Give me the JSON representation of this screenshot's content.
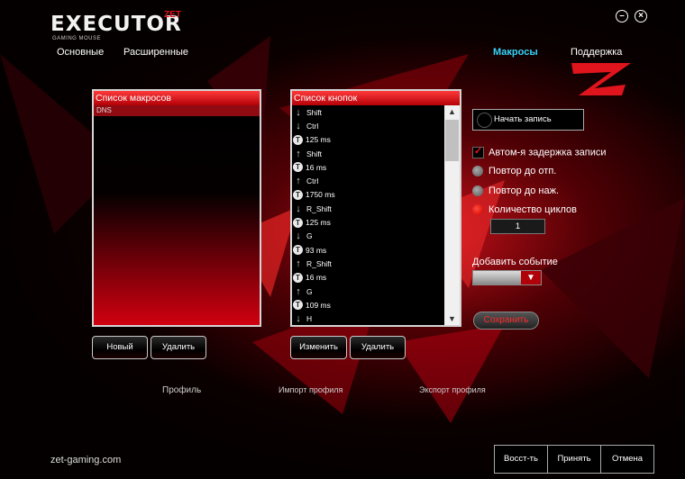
{
  "app": {
    "logo_main": "EXECUTOR",
    "logo_brand": "ZET",
    "logo_sub": "GAMING MOUSE",
    "minimize_icon": "minimize-icon",
    "close_icon": "close-icon"
  },
  "nav": {
    "basic": "Основные",
    "advanced": "Расширенные",
    "macros": "Макросы",
    "support": "Поддержка"
  },
  "macro_panel": {
    "title": "Список макросов",
    "items": [
      "DNS"
    ],
    "new_label": "Новый",
    "delete_label": "Удалить"
  },
  "button_panel": {
    "title": "Список кнопок",
    "rows": [
      {
        "icon": "arrow-down-icon",
        "text": "Shift"
      },
      {
        "icon": "arrow-down-icon",
        "text": "Ctrl"
      },
      {
        "icon": "timer-icon",
        "text": "125 ms"
      },
      {
        "icon": "arrow-up-icon",
        "text": "Shift"
      },
      {
        "icon": "timer-icon",
        "text": "16 ms"
      },
      {
        "icon": "arrow-up-icon",
        "text": "Ctrl"
      },
      {
        "icon": "timer-icon",
        "text": "1750 ms"
      },
      {
        "icon": "arrow-down-icon",
        "text": "R_Shift"
      },
      {
        "icon": "timer-icon",
        "text": "125 ms"
      },
      {
        "icon": "arrow-down-icon",
        "text": "G"
      },
      {
        "icon": "timer-icon",
        "text": "93 ms"
      },
      {
        "icon": "arrow-up-icon",
        "text": "R_Shift"
      },
      {
        "icon": "timer-icon",
        "text": "16 ms"
      },
      {
        "icon": "arrow-up-icon",
        "text": "G"
      },
      {
        "icon": "timer-icon",
        "text": "109 ms"
      },
      {
        "icon": "arrow-down-icon",
        "text": "H"
      }
    ],
    "edit_label": "Изменить",
    "delete_label": "Удалить"
  },
  "recording": {
    "start_label": "Начать запись",
    "auto_delay_label": "Автом-я задержка записи",
    "auto_delay_checked": true,
    "repeat_release_label": "Повтор до отп.",
    "repeat_press_label": "Повтор до наж.",
    "cycle_count_label": "Количество циклов",
    "selected_option": "cycle_count",
    "cycle_count_value": "1",
    "add_event_label": "Добавить событие",
    "save_label": "Сохранить"
  },
  "profile": {
    "profile_label": "Профиль",
    "import_label": "Импорт профиля",
    "export_label": "Экспорт профиля"
  },
  "footer": {
    "site": "zet-gaming.com",
    "restore_label": "Восст-ть",
    "apply_label": "Принять",
    "cancel_label": "Отмена"
  },
  "colors": {
    "accent_red": "#e0141c",
    "active_nav": "#34d3f7",
    "background": "#000000"
  }
}
